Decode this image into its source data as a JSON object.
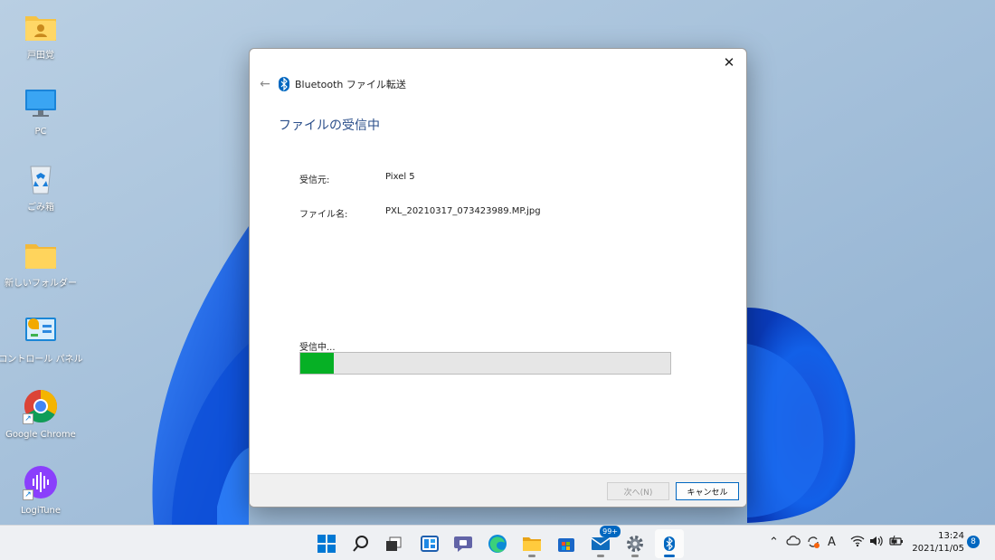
{
  "desktop": {
    "icons": [
      {
        "label": "戸田覚"
      },
      {
        "label": "PC"
      },
      {
        "label": "ごみ箱"
      },
      {
        "label": "新しいフォルダー"
      },
      {
        "label": "コントロール パネル"
      },
      {
        "label": "Google Chrome"
      },
      {
        "label": "LogiTune"
      }
    ]
  },
  "dialog": {
    "title": "Bluetooth ファイル転送",
    "heading": "ファイルの受信中",
    "from_label": "受信元:",
    "from_value": "Pixel 5",
    "filename_label": "ファイル名:",
    "filename_value": "PXL_20210317_073423989.MP.jpg",
    "status": "受信中...",
    "progress": 0.09,
    "progress_color": "#06b025",
    "next_label": "次へ(N)",
    "cancel_label": "キャンセル",
    "close_icon": "close-icon",
    "back_icon": "back-arrow-icon"
  },
  "taskbar": {
    "mail_badge": "99+",
    "clock_time": "13:24",
    "clock_date": "2021/11/05",
    "notification_count": "8",
    "ime_label": "A"
  },
  "colors": {
    "accent": "#0067c0",
    "heading": "#2a4e8a"
  }
}
